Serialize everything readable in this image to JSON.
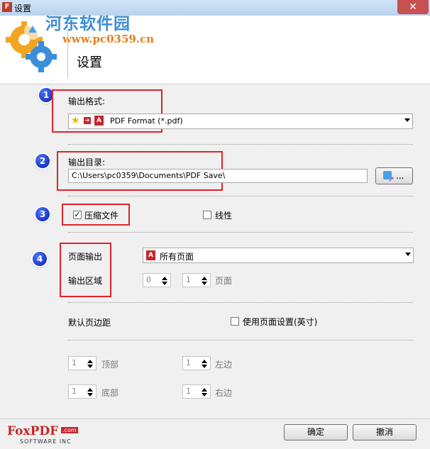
{
  "window": {
    "title": "设置",
    "close_symbol": "✕"
  },
  "watermark": {
    "name": "河东软件园",
    "url": "www.pc0359.cn"
  },
  "header": {
    "title": "设置"
  },
  "badges": [
    "1",
    "2",
    "3",
    "4"
  ],
  "output_format": {
    "label": "输出格式:",
    "value": "PDF Format (*.pdf)"
  },
  "output_dir": {
    "label": "输出目录:",
    "value": "C:\\Users\\pc0359\\Documents\\PDF Save\\",
    "browse_label": "..."
  },
  "compress": {
    "label": "压缩文件",
    "checked": true
  },
  "linear": {
    "label": "线性",
    "checked": false
  },
  "page_output": {
    "label": "页面输出",
    "value": "所有页面"
  },
  "output_range": {
    "label": "输出区域",
    "from": "0",
    "to": "1",
    "unit": "页面"
  },
  "margins": {
    "label": "默认页边距",
    "use_page_setting": "使用页面设置(英寸)",
    "top": {
      "value": "1",
      "label": "顶部"
    },
    "left": {
      "value": "1",
      "label": "左边"
    },
    "bottom": {
      "value": "1",
      "label": "底部"
    },
    "right": {
      "value": "1",
      "label": "右边"
    }
  },
  "logo": {
    "brand": "FoxPDF",
    "suffix": ".com",
    "tagline": "SOFTWARE INC"
  },
  "buttons": {
    "ok": "确定",
    "cancel": "撤消"
  },
  "colors": {
    "highlight": "#e0222b",
    "badge": "#1a3adf",
    "watermark": "#3d8ed6",
    "watermark_url": "#e0821b"
  }
}
